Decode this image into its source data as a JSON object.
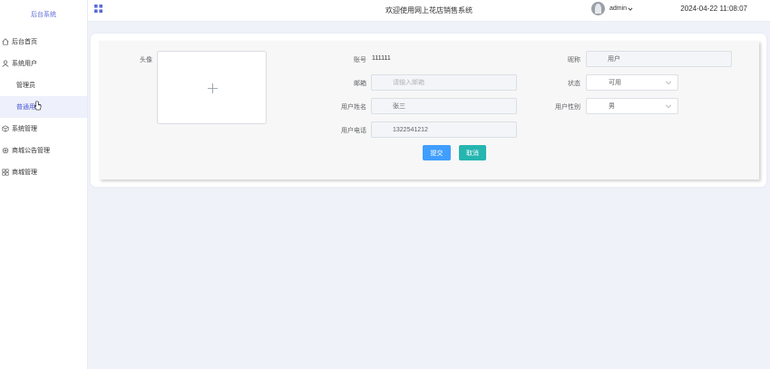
{
  "sidebar": {
    "brand": "后台系统",
    "items": [
      {
        "label": "后台首页",
        "icon": "home-icon"
      },
      {
        "label": "系统用户",
        "icon": "user-icon"
      },
      {
        "label": "管理员"
      },
      {
        "label": "普通用户",
        "active": true
      },
      {
        "label": "系统管理",
        "icon": "cube-icon"
      },
      {
        "label": "商城公告管理",
        "icon": "gear-icon"
      },
      {
        "label": "商城管理",
        "icon": "grid-icon"
      }
    ]
  },
  "header": {
    "welcome": "欢迎使用网上花店销售系统",
    "username": "admin",
    "datetime": "2024-04-22 11:08:07"
  },
  "form": {
    "avatar_label": "头像",
    "account_label": "账号",
    "account_value": "111111",
    "nickname_label": "昵称",
    "nickname_value": "用户",
    "email_label": "邮箱",
    "email_placeholder": "请输入邮箱",
    "status_label": "状态",
    "status_value": "可用",
    "realname_label": "用户姓名",
    "realname_value": "张三",
    "gender_label": "用户性别",
    "gender_value": "男",
    "phone_label": "用户电话",
    "phone_value": "1322541212",
    "submit_label": "提交",
    "cancel_label": "取消"
  },
  "colors": {
    "accent": "#409eff",
    "cancel": "#26b5b0",
    "brand": "#5b6bd6"
  }
}
